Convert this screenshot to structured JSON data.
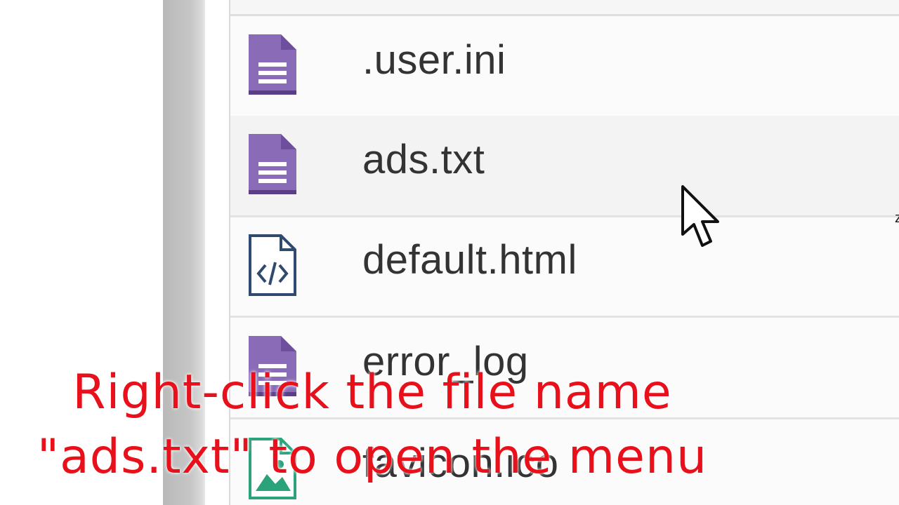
{
  "files": [
    {
      "name": ".user.ini",
      "icon": "text-file-icon"
    },
    {
      "name": "ads.txt",
      "icon": "text-file-icon"
    },
    {
      "name": "default.html",
      "icon": "html-file-icon"
    },
    {
      "name": "error_log",
      "icon": "text-file-icon"
    },
    {
      "name": "favicon.ico",
      "icon": "image-file-icon"
    }
  ],
  "caption": {
    "line1": "Right-click the file name",
    "line2": "\"ads.txt\" to open the menu"
  },
  "colors": {
    "text_file_icon": "#8a6bb8",
    "html_file_icon": "#2f4a6e",
    "image_file_icon": "#2aa37a",
    "caption": "#e8101b",
    "file_name": "#333333"
  },
  "cursor_icon": "mouse-pointer-icon"
}
